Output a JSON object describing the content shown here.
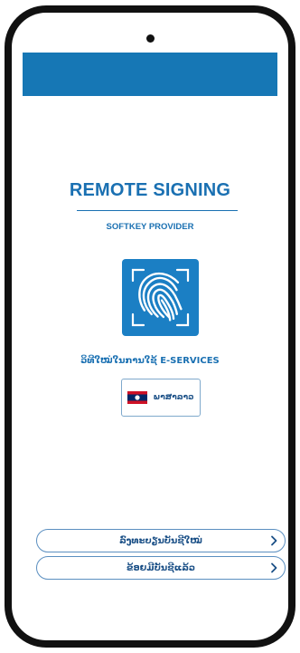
{
  "app": {
    "title": "REMOTE SIGNING",
    "subtitle": "SOFTKEY PROVIDER",
    "tagline": "ວິທີໃໝ່ໃນການໃຊ້ E-SERVICES",
    "brand_color": "#1677b5"
  },
  "icons": {
    "logo": "fingerprint-icon",
    "flag": "laos-flag-icon",
    "chevron": "chevron-right-icon"
  },
  "language": {
    "label": "ພາສາລາວ"
  },
  "actions": {
    "register_label": "ລົງທະບຽນບັນຊີໃໝ່",
    "login_label": "ຂ້ອຍມີບັນຊີແລ້ວ"
  }
}
